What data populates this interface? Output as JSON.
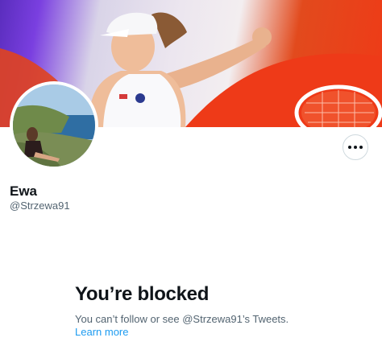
{
  "profile": {
    "name": "Ewa",
    "handle": "@Strzewa91"
  },
  "blocked": {
    "title": "You’re blocked",
    "message": "You can’t follow or see @Strzewa91’s Tweets. ",
    "learn_more": "Learn more"
  },
  "icons": {
    "more": "more-options-icon"
  },
  "colors": {
    "link": "#1d9bf0",
    "secondary_text": "#536471",
    "primary_text": "#0f1419"
  }
}
